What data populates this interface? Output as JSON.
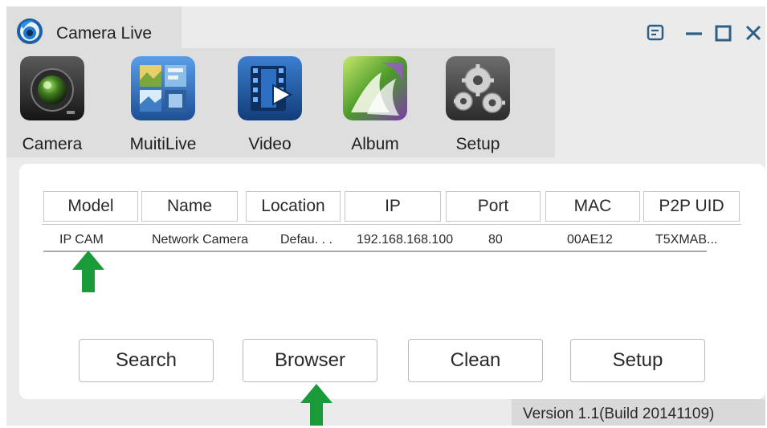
{
  "window": {
    "title": "Camera Live",
    "logo_icon": "camera-live-logo-icon",
    "controls": [
      {
        "name": "menu",
        "icon": "menu-icon"
      },
      {
        "name": "minimize",
        "icon": "minimize-icon"
      },
      {
        "name": "maximize",
        "icon": "maximize-icon"
      },
      {
        "name": "close",
        "icon": "close-icon"
      }
    ]
  },
  "toolbar": {
    "items": [
      {
        "label": "Camera",
        "icon": "camera-lens-icon"
      },
      {
        "label": "MuitiLive",
        "icon": "multi-view-icon"
      },
      {
        "label": "Video",
        "icon": "film-play-icon"
      },
      {
        "label": "Album",
        "icon": "photo-album-icon"
      },
      {
        "label": "Setup",
        "icon": "gears-icon"
      }
    ]
  },
  "device_table": {
    "columns": [
      "Model",
      "Name",
      "Location",
      "IP",
      "Port",
      "MAC",
      "P2P UID"
    ],
    "rows": [
      {
        "model": "IP CAM",
        "name": "Network Camera",
        "location": "Defau. . .",
        "ip": "192.168.168.100",
        "port": "80",
        "mac": "00AE12",
        "p2p_uid": "T5XMAB..."
      }
    ]
  },
  "actions": {
    "search": "Search",
    "browser": "Browser",
    "clean": "Clean",
    "setup": "Setup"
  },
  "annotations": {
    "arrow_color": "#1a9a38",
    "arrow_icon": "green-up-arrow-icon"
  },
  "status": {
    "version": "Version 1.1(Build 20141109)"
  },
  "colors": {
    "window_bg": "#ebebeb",
    "toolbar_bg": "#dedede",
    "panel_bg": "#ffffff",
    "accent_arrow": "#1a9a38"
  }
}
